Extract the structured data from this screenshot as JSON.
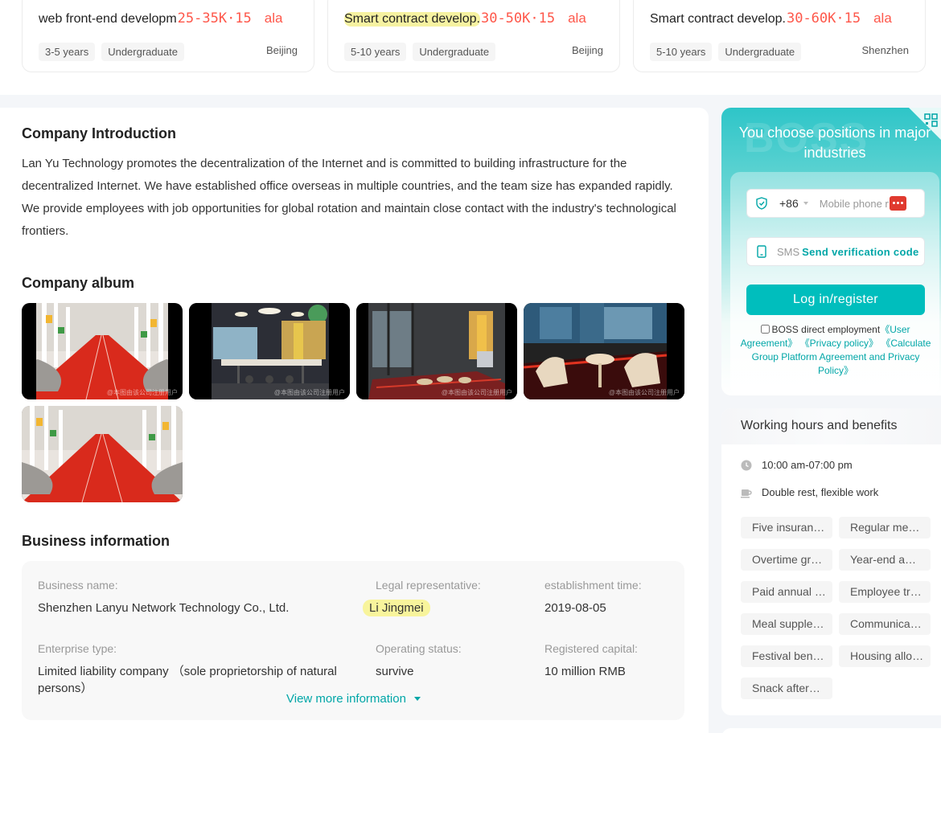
{
  "job_cards": [
    {
      "title": "web front-end developm",
      "salary": "25-35K·15",
      "brand": "ala",
      "experience": "3-5 years",
      "degree": "Undergraduate",
      "city": "Beijing",
      "highlighted": false
    },
    {
      "title": "Smart contract develop.",
      "salary": "30-50K·15",
      "brand": "ala",
      "experience": "5-10 years",
      "degree": "Undergraduate",
      "city": "Beijing",
      "highlighted": true
    },
    {
      "title": "Smart contract develop.",
      "salary": "30-60K·15",
      "brand": "ala",
      "experience": "5-10 years",
      "degree": "Undergraduate",
      "city": "Shenzhen",
      "highlighted": false
    }
  ],
  "intro": {
    "title": "Company Introduction",
    "text": "Lan Yu Technology promotes the decentralization of the Internet and is committed to building infrastructure for the decentralized Internet. We have established office overseas in multiple countries, and the team size has expanded rapidly. We provide employees with job opportunities for global rotation and maintain close contact with the industry's technological frontiers."
  },
  "album": {
    "title": "Company album",
    "watermark": "@本图由该公司注册用户",
    "photos": [
      "red-corridor-office",
      "open-office-lounge",
      "glass-partition-office",
      "lounge-chairs"
    ],
    "photo_count": 5
  },
  "business": {
    "title": "Business information",
    "name_label": "Business name:",
    "name_value": "Shenzhen Lanyu Network Technology Co., Ltd.",
    "rep_label": "Legal representative:",
    "rep_value": "Li Jingmei",
    "est_label": "establishment time:",
    "est_value": "2019-08-05",
    "type_label": "Enterprise type:",
    "type_value": "Limited liability company （sole proprietorship of natural persons）",
    "status_label": "Operating status:",
    "status_value": "survive",
    "capital_label": "Registered capital:",
    "capital_value": "10 million RMB",
    "more_label": "View more information"
  },
  "login": {
    "bg_word": "BOSS",
    "slogan": "You choose positions in major industries",
    "country_code": "+86",
    "phone_placeholder": "Mobile phone number",
    "sms_placeholder": "SMS",
    "send_code": "Send verification code",
    "button": "Log in/register",
    "agree_prefix": "BOSS direct employment",
    "agree_links": "《User Agreement》 《Privacy policy》 《Calculate Group Platform Agreement and Privacy Policy》"
  },
  "benefits": {
    "title": "Working hours and benefits",
    "hours": "10:00 am-07:00 pm",
    "rest": "Double rest, flexible work",
    "perks": [
      "Five insurance and one fund",
      "Regular medical examination",
      "Overtime granted",
      "Year-end award",
      "Paid annual leave",
      "Employee travel",
      "Meal supplement",
      "Communication subsidy",
      "Festival benefits",
      "Housing allowance",
      "Snack afternoon tea"
    ]
  },
  "colors": {
    "accent": "#00a6a7",
    "salary": "#fe574a",
    "button": "#00bebd",
    "highlight": "#f8f49c"
  }
}
